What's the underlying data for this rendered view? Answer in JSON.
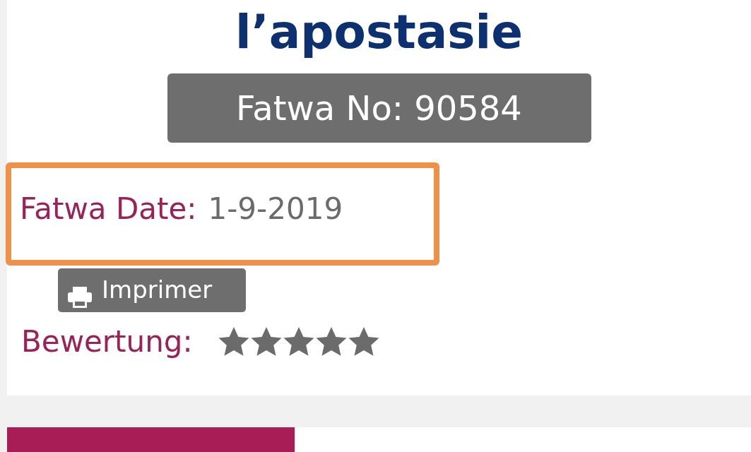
{
  "title": "l’apostasie",
  "fatwa_number": "Fatwa No: 90584",
  "fatwa_date": {
    "label": "Fatwa Date:",
    "value": "1-9-2019",
    "highlighted": true
  },
  "print_button": {
    "label": "Imprimer"
  },
  "rating": {
    "label": "Bewertung:",
    "stars": 5
  }
}
